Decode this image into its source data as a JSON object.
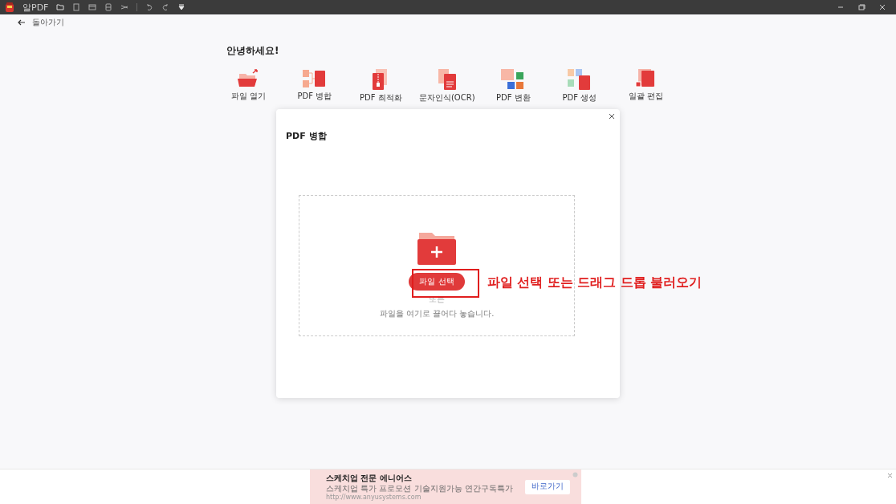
{
  "app": {
    "title": "알PDF"
  },
  "back": {
    "label": "돌아가기"
  },
  "greeting": "안녕하세요!",
  "tools": [
    {
      "label": "파일 열기",
      "kind": "open"
    },
    {
      "label": "PDF 병합",
      "kind": "merge"
    },
    {
      "label": "PDF 최적화",
      "kind": "zip"
    },
    {
      "label": "문자인식(OCR)",
      "kind": "ocr"
    },
    {
      "label": "PDF 변환",
      "kind": "convert"
    },
    {
      "label": "PDF 생성",
      "kind": "create"
    },
    {
      "label": "일괄 편집",
      "kind": "batch"
    }
  ],
  "dialog": {
    "title": "PDF 병합",
    "select_button": "파일 선택",
    "or": "또는",
    "drop_hint": "파일을 여기로 끌어다 놓습니다."
  },
  "annotation": {
    "text": "파일 선택 또는 드래그 드롭 불러오기"
  },
  "ad": {
    "title": "스케치업 전문 에니어스",
    "subtitle": "스케치업 특가 프로모션 기술지원가능 연간구독특가",
    "url": "http://www.anyusystems.com",
    "button": "바로가기"
  }
}
